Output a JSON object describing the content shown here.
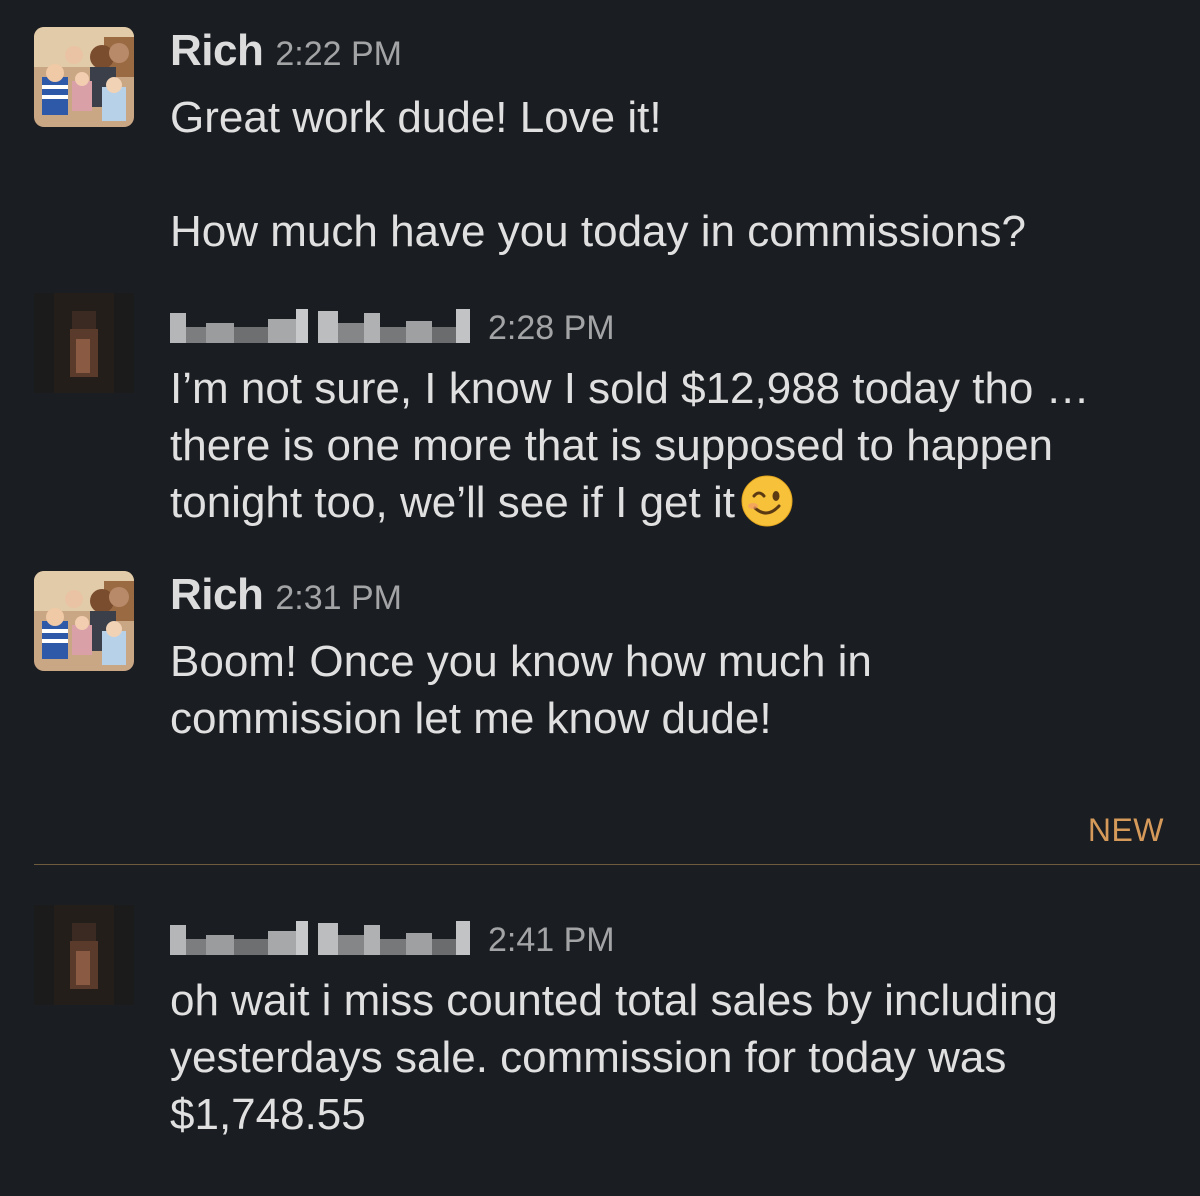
{
  "messages": [
    {
      "author": "Rich",
      "time": "2:22 PM",
      "lines": [
        "Great work dude! Love it!",
        "How much have you today in commissions?"
      ]
    },
    {
      "author": "",
      "time": "2:28 PM",
      "lines": [
        "I’m not sure, I know I sold $12,988 today tho … there is one more that is supposed to happen tonight too, we’ll see if I get it"
      ],
      "emoji": "winking-face"
    },
    {
      "author": "Rich",
      "time": "2:31 PM",
      "lines": [
        "Boom! Once you know how much in commission let me know dude!"
      ]
    },
    {
      "author": "",
      "time": "2:41 PM",
      "lines": [
        "oh wait i miss counted total sales by including yesterdays sale. commission for today was $1,748.55"
      ]
    }
  ],
  "divider": {
    "label": "NEW",
    "color": "#d59a5a"
  },
  "colors": {
    "background": "#1a1d21",
    "text": "#e0e0e1",
    "timestamp": "#a3a4a6"
  }
}
